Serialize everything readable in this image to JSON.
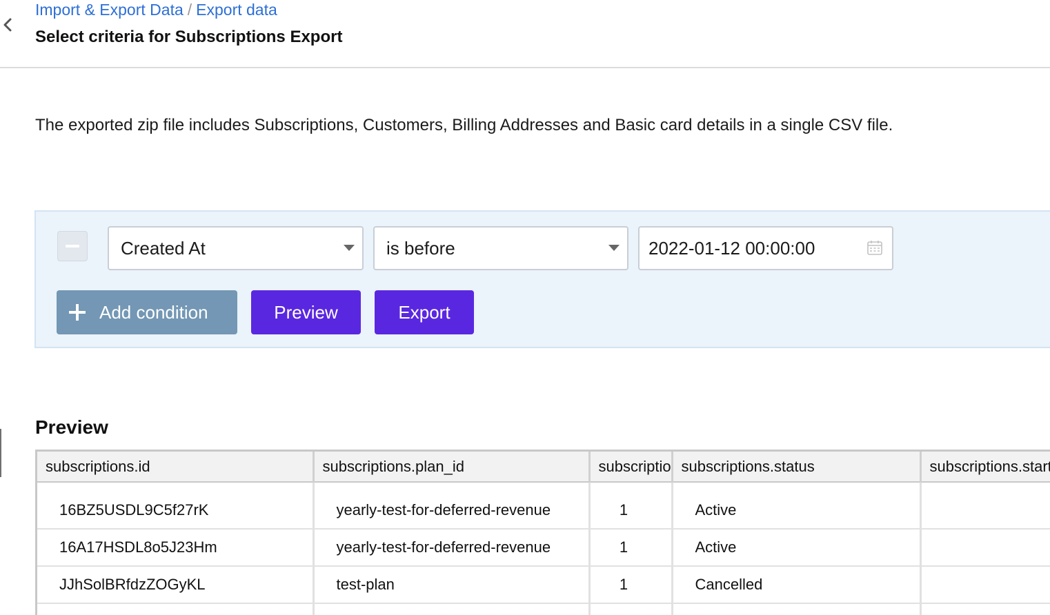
{
  "header": {
    "breadcrumb": [
      "Import & Export Data",
      "Export data"
    ],
    "breadcrumb_separator": "/",
    "title": "Select criteria for Subscriptions Export"
  },
  "description": "The exported zip file includes Subscriptions, Customers, Billing Addresses and Basic card details in a single CSV file.",
  "criteria": {
    "attribute": "Created At",
    "operator": "is before",
    "value": "2022-01-12 00:00:00",
    "add_condition_label": "Add condition",
    "preview_label": "Preview",
    "export_label": "Export"
  },
  "preview": {
    "title": "Preview",
    "columns": [
      "subscriptions.id",
      "subscriptions.plan_id",
      "subscriptions.plan_quantity",
      "subscriptions.status",
      "subscriptions.started_at"
    ],
    "rows": [
      [
        "16BZ5USDL9C5f27rK",
        "yearly-test-for-deferred-revenue",
        "1",
        "Active",
        ""
      ],
      [
        "16A17HSDL8o5J23Hm",
        "yearly-test-for-deferred-revenue",
        "1",
        "Active",
        ""
      ],
      [
        "JJhSolBRfdzZOGyKL",
        "test-plan",
        "1",
        "Cancelled",
        ""
      ],
      [
        "",
        "",
        "",
        "",
        ""
      ]
    ]
  },
  "colors": {
    "link": "#2d6fd6",
    "primary_button": "#5a27e0",
    "secondary_button": "#7397b4",
    "panel_background": "#ebf3fb"
  },
  "icons": {
    "back": "chevron-left-icon",
    "remove": "minus-icon",
    "dropdown": "caret-down-icon",
    "calendar": "calendar-icon",
    "add": "plus-icon"
  }
}
